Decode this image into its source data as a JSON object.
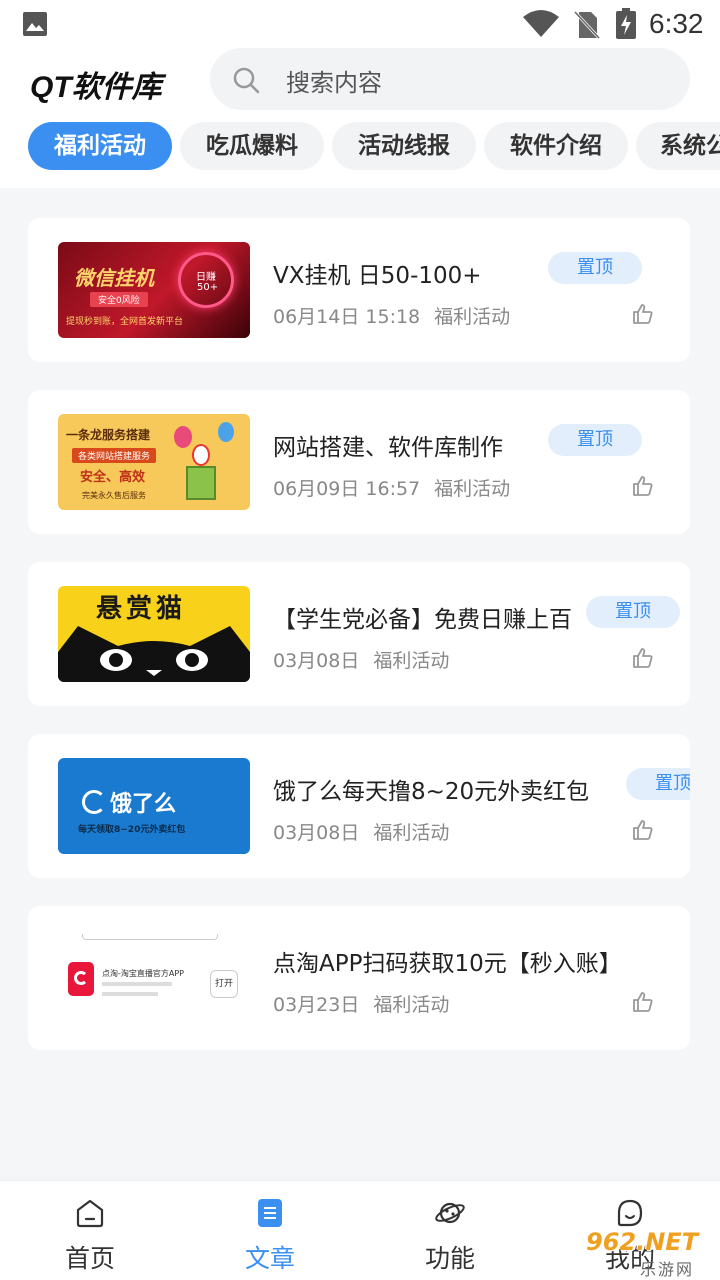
{
  "status": {
    "time": "6:32"
  },
  "header": {
    "title": "QT软件库",
    "search_placeholder": "搜索内容"
  },
  "tabs": [
    {
      "label": "福利活动",
      "active": true
    },
    {
      "label": "吃瓜爆料",
      "active": false
    },
    {
      "label": "活动线报",
      "active": false
    },
    {
      "label": "软件介绍",
      "active": false
    },
    {
      "label": "系统公",
      "active": false
    }
  ],
  "articles": [
    {
      "title": "VX挂机 日50-100+",
      "date": "06月14日 15:18",
      "category": "福利活动",
      "pin": "置顶",
      "thumb": {
        "line1": "微信挂机",
        "line2": "安全0风险",
        "line3": "提现秒到账，全网首发新平台",
        "badge1": "日赚",
        "badge2": "50+"
      }
    },
    {
      "title": "网站搭建、软件库制作",
      "date": "06月09日 16:57",
      "category": "福利活动",
      "pin": "置顶",
      "thumb": {
        "line1": "一条龙服务搭建",
        "line2": "各类网站搭建服务",
        "line3": "安全、高效",
        "line4": "完美永久售后服务"
      }
    },
    {
      "title": "【学生党必备】免费日赚上百",
      "date": "03月08日",
      "category": "福利活动",
      "pin": "置顶",
      "thumb": {
        "line1": "悬赏猫"
      }
    },
    {
      "title": "饿了么每天撸8~20元外卖红包",
      "date": "03月08日",
      "category": "福利活动",
      "pin": "置顶",
      "thumb": {
        "line1": "饿了么",
        "line2": "每天领取8~20元外卖红包"
      }
    },
    {
      "title": "点淘APP扫码获取10元【秒入账】",
      "date": "03月23日",
      "category": "福利活动",
      "pin": "",
      "thumb": {
        "line1": "点淘-淘宝直播官方APP",
        "btn": "打开"
      }
    }
  ],
  "bottom_nav": [
    {
      "label": "首页",
      "icon": "home-icon",
      "active": false
    },
    {
      "label": "文章",
      "icon": "article-icon",
      "active": true
    },
    {
      "label": "功能",
      "icon": "planet-icon",
      "active": false
    },
    {
      "label": "我的",
      "icon": "profile-icon",
      "active": false
    }
  ],
  "watermark": {
    "text": "962.NET",
    "sub": "乐游网"
  },
  "colors": {
    "accent": "#3a8ff0",
    "pin_bg": "#e3eefc"
  }
}
